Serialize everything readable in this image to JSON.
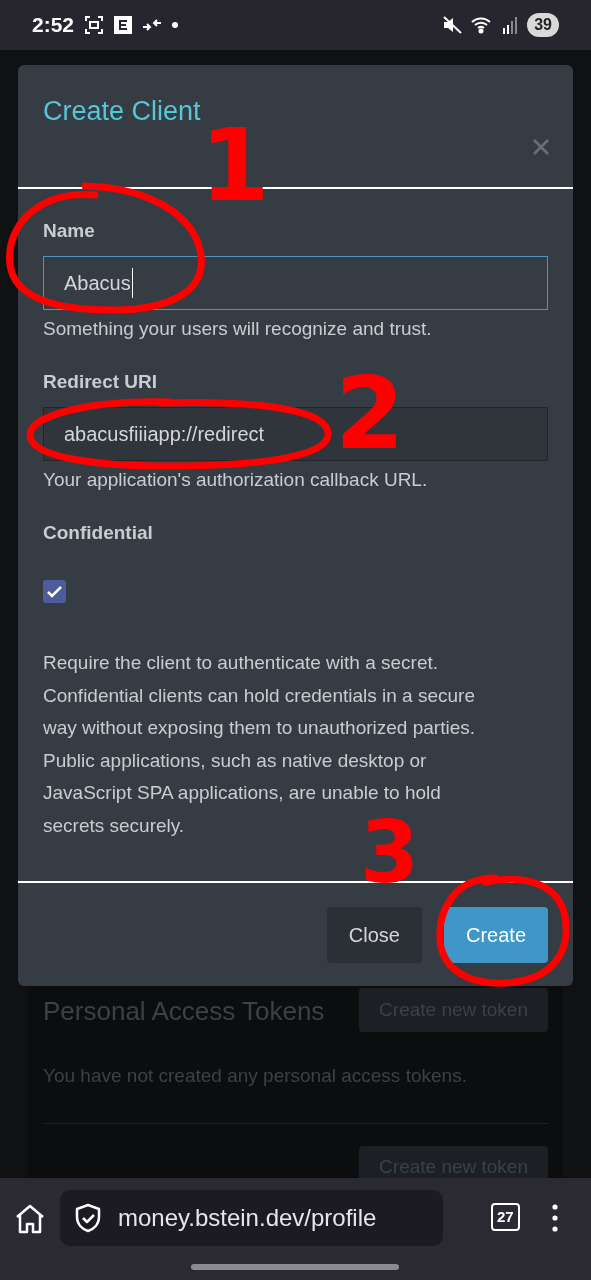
{
  "status_bar": {
    "time": "2:52",
    "battery": "39"
  },
  "page": {
    "section_title": "Personal Access Tokens",
    "create_token_buttons": [
      "Create new token",
      "Create new token"
    ],
    "empty_message": "You have not created any personal access tokens."
  },
  "modal": {
    "title": "Create Client",
    "fields": [
      {
        "kind": "text",
        "label": "Name",
        "value": "Abacus",
        "focused": true,
        "help": "Something your users will recognize and trust."
      },
      {
        "kind": "text",
        "label": "Redirect URI",
        "value": "abacusfiiiapp://redirect",
        "focused": false,
        "help": "Your application's authorization callback URL."
      },
      {
        "kind": "checkbox",
        "label": "Confidential",
        "checked": true,
        "help": "Require the client to authenticate with a secret. Confidential clients can hold credentials in a secure way without exposing them to unauthorized parties. Public applications, such as native desktop or JavaScript SPA applications, are unable to hold secrets securely."
      }
    ],
    "buttons": [
      {
        "label": "Close",
        "primary": false
      },
      {
        "label": "Create",
        "primary": true
      }
    ]
  },
  "annotations": {
    "numbers": [
      "1",
      "2",
      "3"
    ]
  },
  "browser_bar": {
    "url": "money.bstein.dev/profile",
    "tab_count": "27"
  }
}
